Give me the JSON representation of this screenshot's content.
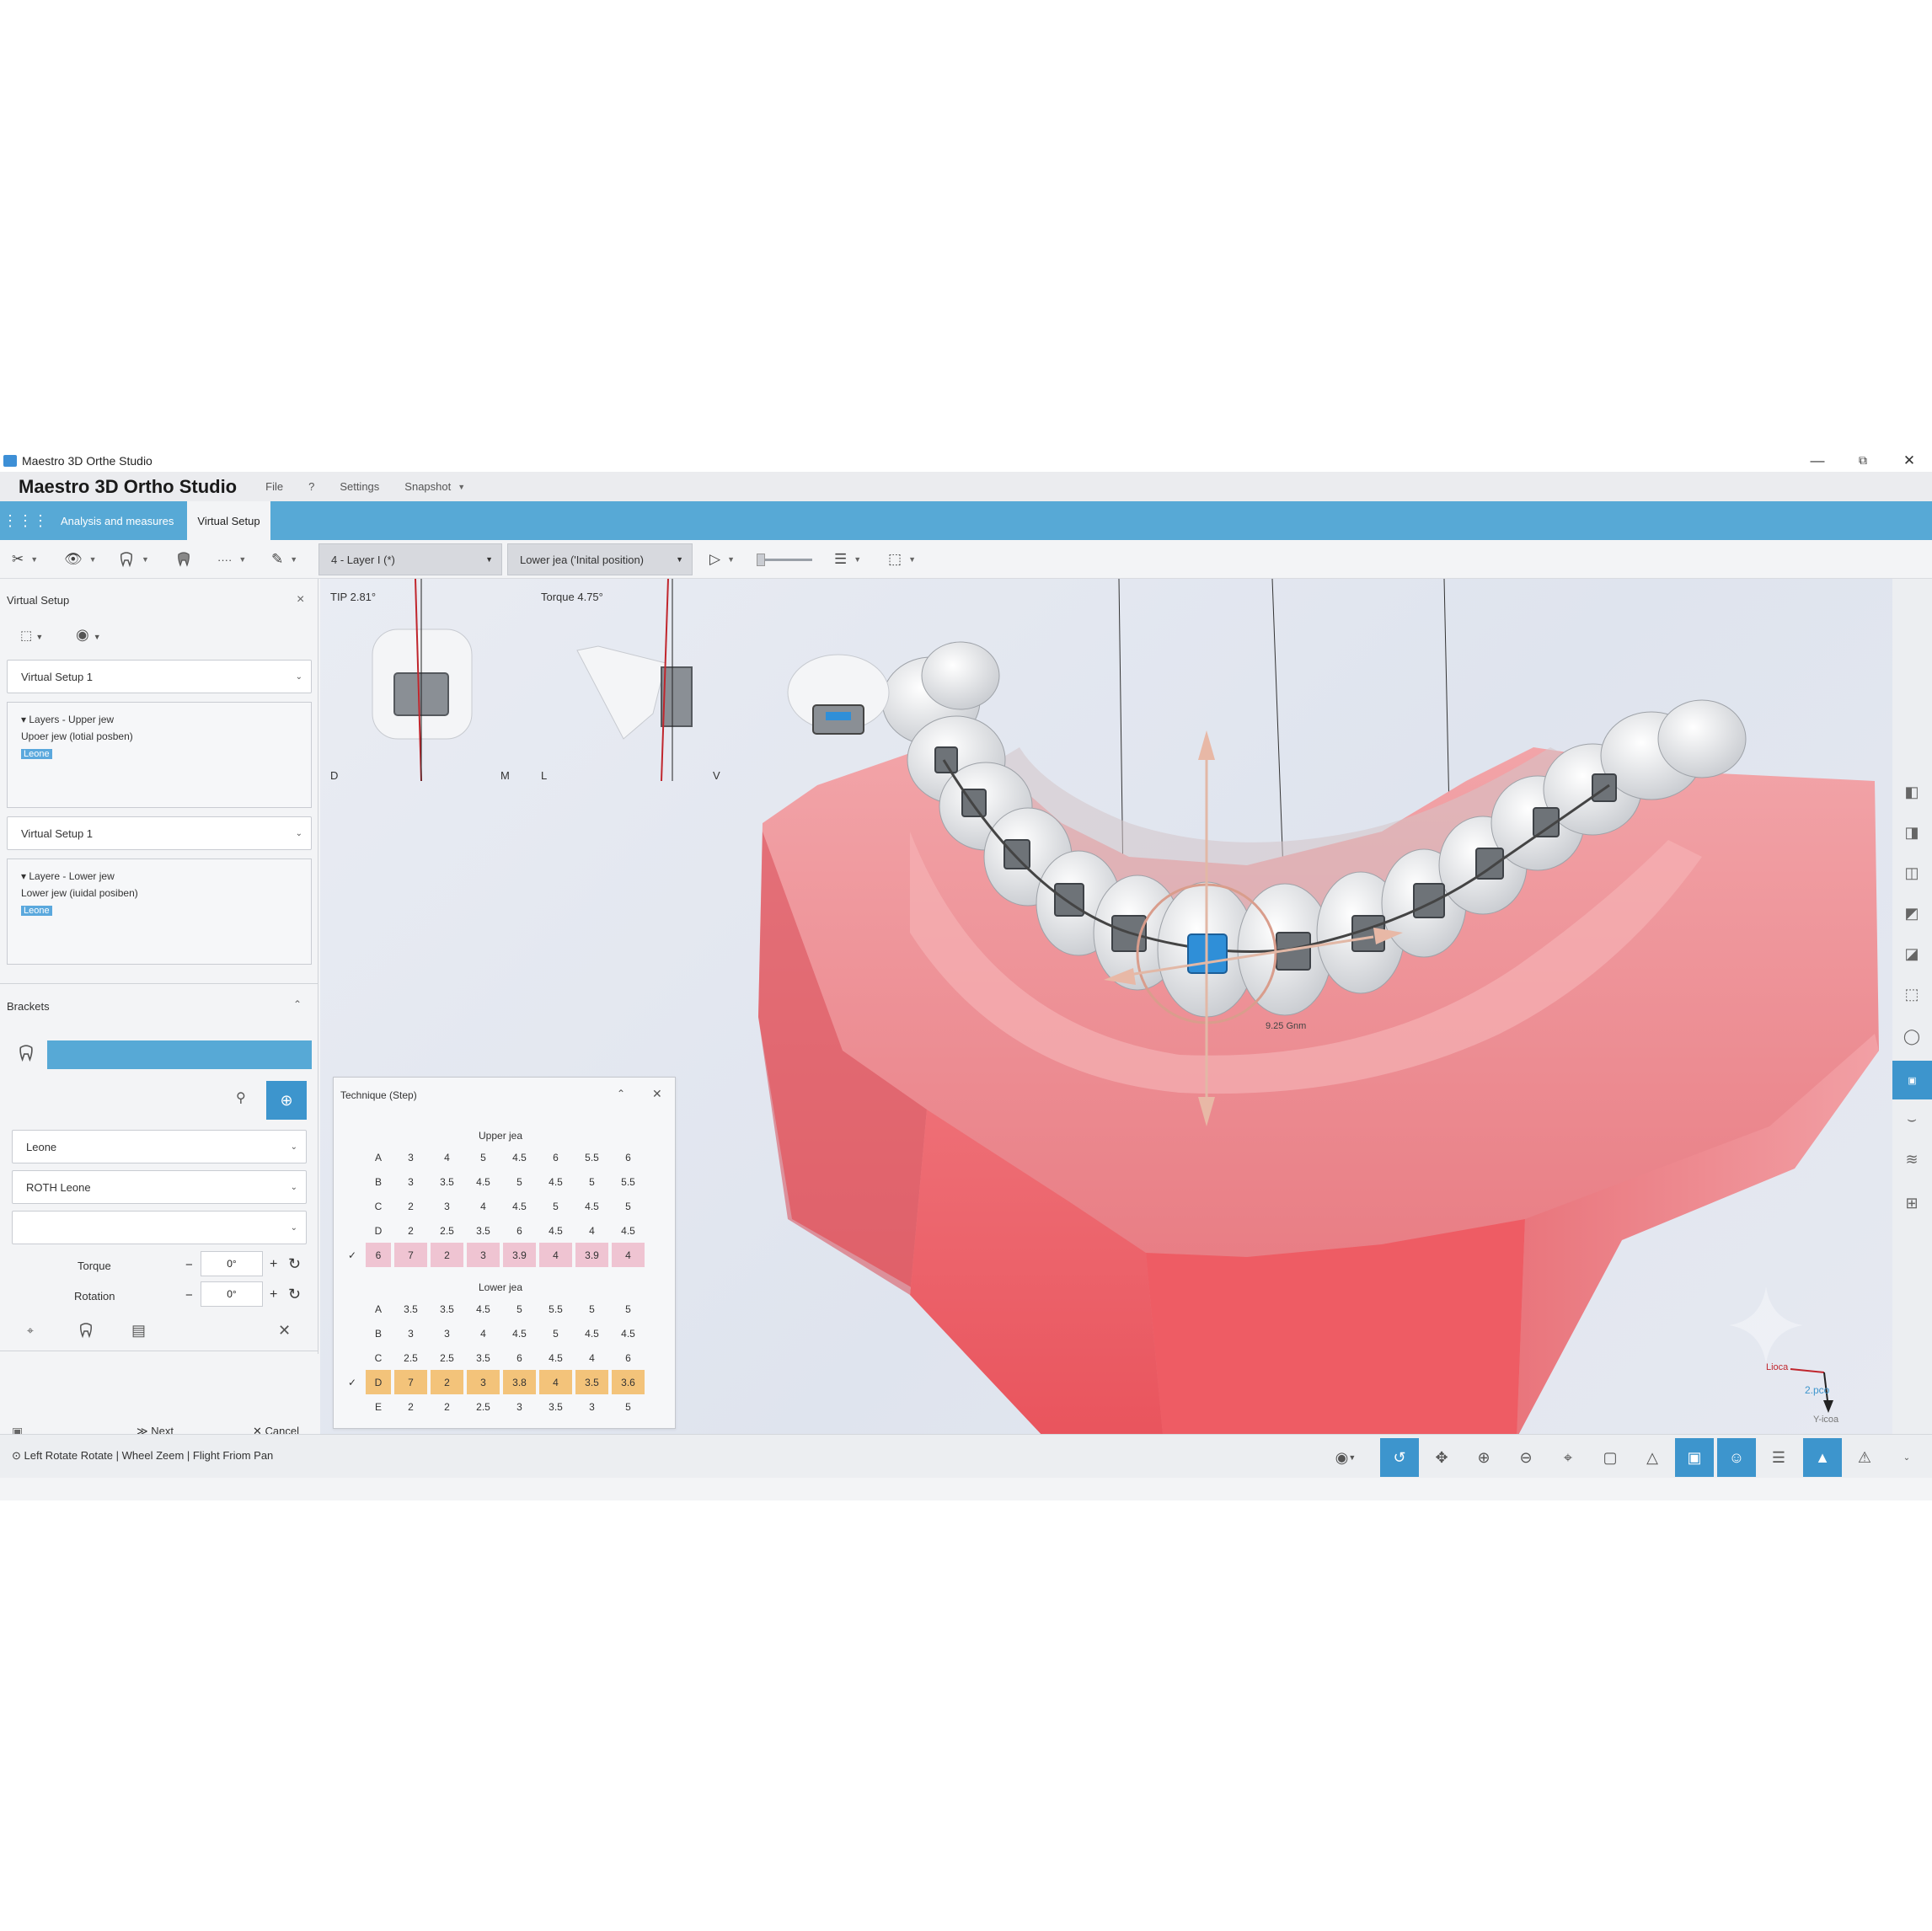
{
  "window": {
    "title": "Maestro 3D Orthe Studio",
    "minimize": "—",
    "restore": "⧉",
    "close": "✕"
  },
  "menu": {
    "brand": "Maestro 3D Ortho Studio",
    "items": [
      "File",
      "?",
      "Settings",
      "Snapshot"
    ]
  },
  "tabs": {
    "apps_icon": "grid-icon",
    "items": [
      "Analysis and measures",
      "Virtual Setup"
    ],
    "active": "Virtual Setup"
  },
  "toolbar": {
    "layer_select": "4 - Layer I (*)",
    "position_select": "Lower jea ('Inital position)",
    "ellipsis": "····"
  },
  "left_panel": {
    "title": "Virtual Setup",
    "close": "×",
    "setup_select_1": "Virtual Setup 1",
    "upper_layers": {
      "heading": "Layers - Upper jew",
      "item": "Upoer jew (lotial posben)",
      "tag": "Leone"
    },
    "setup_select_2": "Virtual Setup 1",
    "lower_layers": {
      "heading": "Layere - Lower jew",
      "item": "Lower jew (iuidal posiben)",
      "tag": "Leone"
    },
    "brackets_title": "Brackets",
    "brand_select": "Leone",
    "prescription_select": "ROTH Leone",
    "torque_label": "Torque",
    "torque_value": "0°",
    "rotation_label": "Rotation",
    "rotation_value": "0°",
    "next": "Next",
    "cancel": "Cancel"
  },
  "viewport": {
    "tip_label": "TIP 2.81°",
    "torque_label": "Torque 4.75°",
    "dir_d": "D",
    "dir_m": "M",
    "dir_l": "L",
    "dir_v": "V",
    "measure_label": "9.25 Gnm",
    "axis_x": "Lioca",
    "axis_z": "2.pco",
    "axis_y": "Y-icoa"
  },
  "technique": {
    "title": "Technique (Step)",
    "upper_title": "Upper jea",
    "upper_rows": [
      {
        "label": "A",
        "values": [
          "3",
          "4",
          "5",
          "4.5",
          "6",
          "5.5",
          "6"
        ],
        "checked": false
      },
      {
        "label": "B",
        "values": [
          "3",
          "3.5",
          "4.5",
          "5",
          "4.5",
          "5",
          "5.5"
        ],
        "checked": false
      },
      {
        "label": "C",
        "values": [
          "2",
          "3",
          "4",
          "4.5",
          "5",
          "4.5",
          "5"
        ],
        "checked": false
      },
      {
        "label": "D",
        "values": [
          "2",
          "2.5",
          "3.5",
          "6",
          "4.5",
          "4",
          "4.5"
        ],
        "checked": false
      },
      {
        "label": "6",
        "values": [
          "7",
          "2",
          "3",
          "3.9",
          "4",
          "3.9",
          "4"
        ],
        "checked": true
      }
    ],
    "lower_title": "Lower jea",
    "lower_rows": [
      {
        "label": "A",
        "values": [
          "3.5",
          "3.5",
          "4.5",
          "5",
          "5.5",
          "5",
          "5"
        ],
        "checked": false
      },
      {
        "label": "B",
        "values": [
          "3",
          "3",
          "4",
          "4.5",
          "5",
          "4.5",
          "4.5"
        ],
        "checked": false
      },
      {
        "label": "C",
        "values": [
          "2.5",
          "2.5",
          "3.5",
          "6",
          "4.5",
          "4",
          "6"
        ],
        "checked": false
      },
      {
        "label": "D",
        "values": [
          "7",
          "2",
          "3",
          "3.8",
          "4",
          "3.5",
          "3.6"
        ],
        "checked": true
      },
      {
        "label": "E",
        "values": [
          "2",
          "2",
          "2.5",
          "3",
          "3.5",
          "3",
          "5"
        ],
        "checked": false
      }
    ],
    "colors": {
      "upper_selected": "#efc4d2",
      "lower_selected": "#f3c37a"
    }
  },
  "status": {
    "hint": "Left Rotate  Rotate | Wheel Zeem | Flight Friom  Pan"
  },
  "colors": {
    "accent": "#57a9d6",
    "active_button": "#3d95cd",
    "gum": "#e8636c",
    "bracket_highlight": "#2f8fd8"
  }
}
